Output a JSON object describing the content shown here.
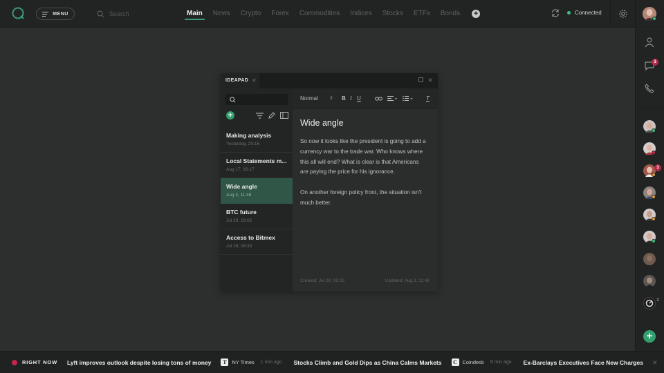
{
  "topbar": {
    "menu_label": "MENU",
    "search_placeholder": "Search",
    "tabs": [
      "Main",
      "News",
      "Crypto",
      "Forex",
      "Commodities",
      "Indices",
      "Stocks",
      "ETFs",
      "Bonds"
    ],
    "active_tab": "Main",
    "connection_status": "Connected"
  },
  "right_sidebar": {
    "messages_badge": "3",
    "contacts": [
      {
        "status": "online",
        "badge": ""
      },
      {
        "status": "busy",
        "badge": ""
      },
      {
        "status": "away",
        "badge": "3"
      },
      {
        "status": "away",
        "badge": ""
      },
      {
        "status": "away",
        "badge": ""
      },
      {
        "status": "online",
        "badge": ""
      },
      {
        "status": "",
        "badge": ""
      },
      {
        "status": "",
        "badge": ""
      },
      {
        "status": "",
        "badge": "1"
      }
    ]
  },
  "ideapad": {
    "tab_label": "IDEAPAD",
    "notes": [
      {
        "title": "Making analysis",
        "date": "Yesterday, 20:16"
      },
      {
        "title": "Local Statements m...",
        "date": "Aug 17, 16:17"
      },
      {
        "title": "Wide angle",
        "date": "Aug 3, 11:48"
      },
      {
        "title": "BTC future",
        "date": "Jul 29, 18:02"
      },
      {
        "title": "Access to Bitmex",
        "date": "Jul 28, 08:33"
      }
    ],
    "selected_note_index": 2,
    "editor": {
      "format_select": "Normal",
      "title": "Wide angle",
      "paragraphs": [
        "So now it looks like the president is going to add a currency war to the trade war. Who knows where this all will end? What is clear is that Americans are paying the price for his ignorance.",
        "On another foreign policy front, the situation isn't much better."
      ],
      "created": "Created: Jul 28, 08:33",
      "updated": "Updated: Aug 3, 11:48"
    }
  },
  "ticker": {
    "label": "RIGHT NOW",
    "items": [
      {
        "headline": "Lyft improves outlook despite losing tons of money",
        "source": "NY Times",
        "ago": "1 min ago",
        "icon": "nytimes-icon"
      },
      {
        "headline": "Stocks Climb and Gold Dips as China Calms Markets",
        "source": "Coindesk",
        "ago": "8 min ago",
        "icon": "coindesk-icon"
      },
      {
        "headline": "Ex-Barclays Executives Face New Charges",
        "source": "",
        "ago": "",
        "icon": ""
      }
    ]
  },
  "colors": {
    "accent": "#3a9a74",
    "badge": "#b2294a",
    "background": "#2c2f2e"
  }
}
